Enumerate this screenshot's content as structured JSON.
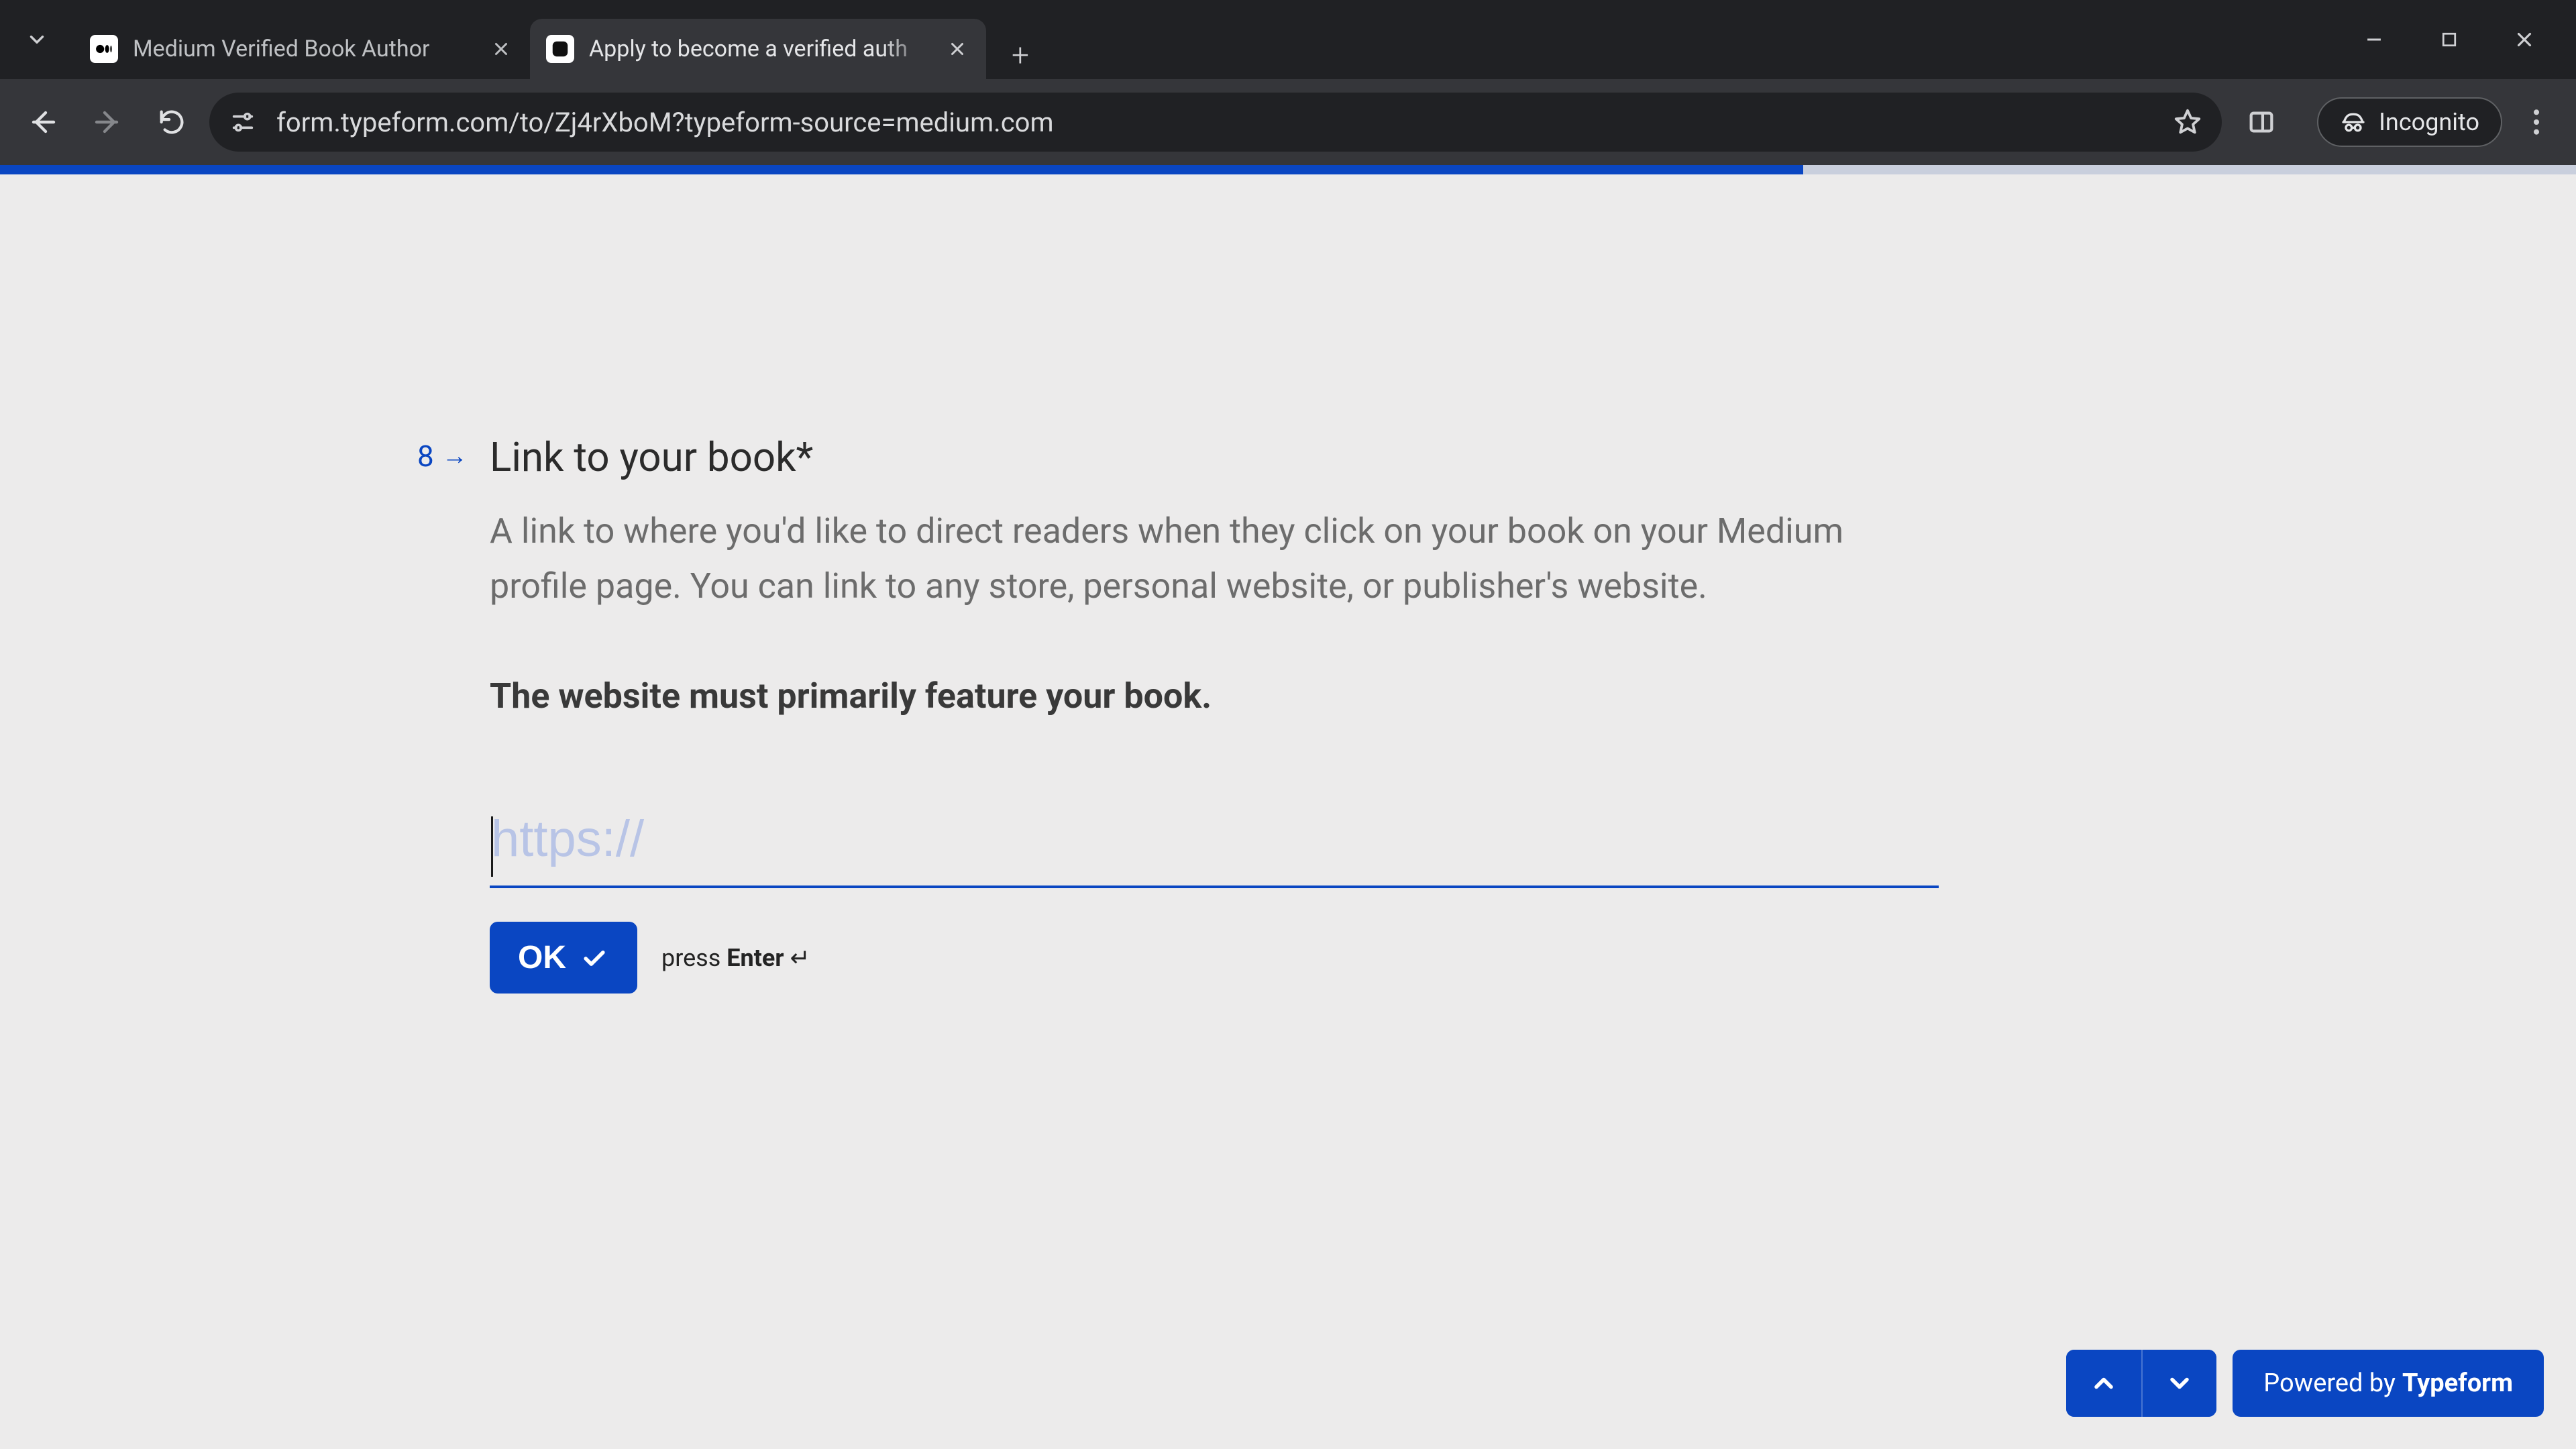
{
  "browser": {
    "tabs": [
      {
        "title": "Medium Verified Book Author",
        "active": false
      },
      {
        "title": "Apply to become a verified auth",
        "active": true
      }
    ],
    "url": "form.typeform.com/to/Zj4rXboM?typeform-source=medium.com",
    "incognito_label": "Incognito"
  },
  "form": {
    "progress_percent": 70,
    "question_number": "8",
    "title": "Link to your book*",
    "description": "A link to where you'd like to direct readers when they click on your book on your Medium profile page. You can link to any store, personal website, or publisher's website.",
    "emphasis": "The website must primarily feature your book.",
    "input_placeholder": "https://",
    "input_value": "",
    "ok_label": "OK",
    "hint_prefix": "press ",
    "hint_key": "Enter",
    "hint_symbol": " ↵"
  },
  "footer": {
    "powered_prefix": "Powered by ",
    "powered_brand": "Typeform"
  }
}
